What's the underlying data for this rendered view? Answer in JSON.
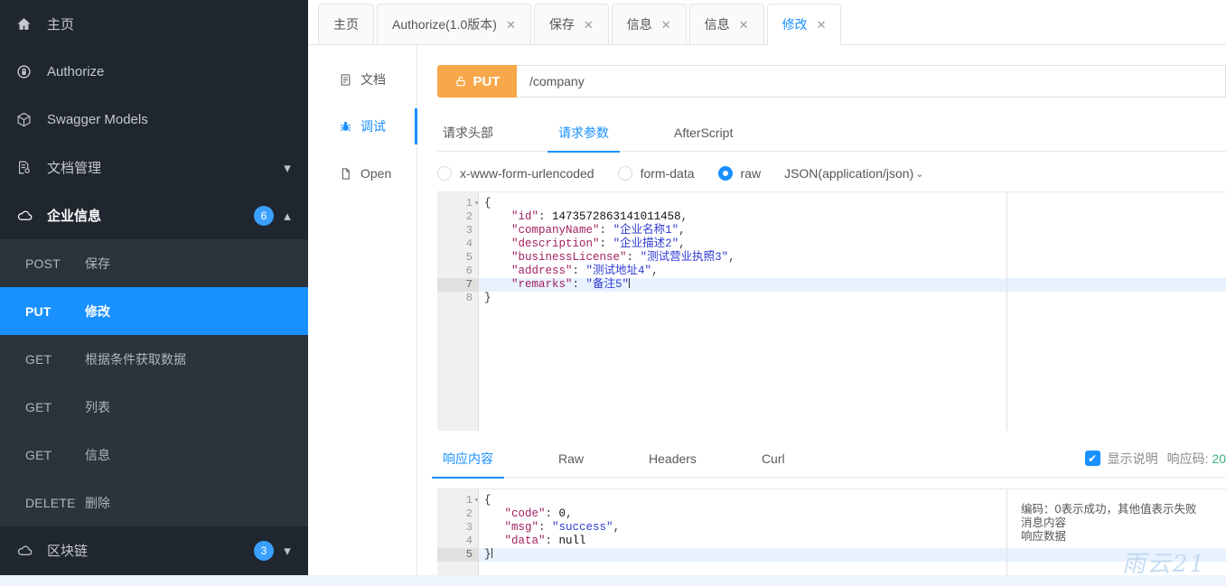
{
  "sidebar": {
    "items": [
      {
        "label": "主页",
        "icon": "home-icon",
        "kind": "link"
      },
      {
        "label": "Authorize",
        "icon": "lock-icon",
        "kind": "link"
      },
      {
        "label": "Swagger Models",
        "icon": "cube-icon",
        "kind": "link"
      },
      {
        "label": "文档管理",
        "icon": "document-settings-icon",
        "kind": "group",
        "caret": "▾"
      },
      {
        "label": "企业信息",
        "icon": "cloud-icon",
        "kind": "group",
        "badge": "6",
        "caret": "▴",
        "expanded": true
      },
      {
        "label": "区块链",
        "icon": "cloud-icon",
        "kind": "group",
        "badge": "3",
        "caret": "▾"
      }
    ],
    "submenu": [
      {
        "method": "POST",
        "name": "保存",
        "active": false
      },
      {
        "method": "PUT",
        "name": "修改",
        "active": true
      },
      {
        "method": "GET",
        "name": "根据条件获取数据",
        "active": false
      },
      {
        "method": "GET",
        "name": "列表",
        "active": false
      },
      {
        "method": "GET",
        "name": "信息",
        "active": false
      },
      {
        "method": "DELETE",
        "name": "删除",
        "active": false
      }
    ]
  },
  "tabs": [
    {
      "label": "主页",
      "closable": false,
      "active": false
    },
    {
      "label": "Authorize(1.0版本)",
      "closable": true,
      "active": false
    },
    {
      "label": "保存",
      "closable": true,
      "active": false
    },
    {
      "label": "信息",
      "closable": true,
      "active": false
    },
    {
      "label": "信息",
      "closable": true,
      "active": false
    },
    {
      "label": "修改",
      "closable": true,
      "active": true
    }
  ],
  "tab_close_glyph": "✕",
  "rail": [
    {
      "label": "文档",
      "icon": "doc-icon",
      "active": false
    },
    {
      "label": "调试",
      "icon": "bug-icon",
      "active": true
    },
    {
      "label": "Open",
      "icon": "file-icon",
      "active": false
    }
  ],
  "request": {
    "method": "PUT",
    "method_icon": "unlock-icon",
    "url": "/company",
    "subtabs": [
      {
        "label": "请求头部",
        "active": false
      },
      {
        "label": "请求参数",
        "active": true
      },
      {
        "label": "AfterScript",
        "active": false
      }
    ],
    "body_types": [
      {
        "label": "x-www-form-urlencoded",
        "checked": false
      },
      {
        "label": "form-data",
        "checked": false
      },
      {
        "label": "raw",
        "checked": true
      }
    ],
    "content_type": "JSON(application/json)",
    "content_type_chevron": "⌄",
    "editor": {
      "current_line": 7,
      "lines": [
        {
          "no": "1",
          "fold": "▾",
          "tokens": [
            {
              "t": "{",
              "c": "p"
            }
          ]
        },
        {
          "no": "2",
          "tokens": [
            {
              "t": "    ",
              "c": "p"
            },
            {
              "t": "\"id\"",
              "c": "k"
            },
            {
              "t": ": ",
              "c": "p"
            },
            {
              "t": "1473572863141011458",
              "c": "n"
            },
            {
              "t": ",",
              "c": "p"
            }
          ]
        },
        {
          "no": "3",
          "tokens": [
            {
              "t": "    ",
              "c": "p"
            },
            {
              "t": "\"companyName\"",
              "c": "k"
            },
            {
              "t": ": ",
              "c": "p"
            },
            {
              "t": "\"企业名称1\"",
              "c": "s"
            },
            {
              "t": ",",
              "c": "p"
            }
          ]
        },
        {
          "no": "4",
          "tokens": [
            {
              "t": "    ",
              "c": "p"
            },
            {
              "t": "\"description\"",
              "c": "k"
            },
            {
              "t": ": ",
              "c": "p"
            },
            {
              "t": "\"企业描述2\"",
              "c": "s"
            },
            {
              "t": ",",
              "c": "p"
            }
          ]
        },
        {
          "no": "5",
          "tokens": [
            {
              "t": "    ",
              "c": "p"
            },
            {
              "t": "\"businessLicense\"",
              "c": "k"
            },
            {
              "t": ": ",
              "c": "p"
            },
            {
              "t": "\"测试营业执照3\"",
              "c": "s"
            },
            {
              "t": ",",
              "c": "p"
            }
          ]
        },
        {
          "no": "6",
          "tokens": [
            {
              "t": "    ",
              "c": "p"
            },
            {
              "t": "\"address\"",
              "c": "k"
            },
            {
              "t": ": ",
              "c": "p"
            },
            {
              "t": "\"测试地址4\"",
              "c": "s"
            },
            {
              "t": ",",
              "c": "p"
            }
          ]
        },
        {
          "no": "7",
          "tokens": [
            {
              "t": "    ",
              "c": "p"
            },
            {
              "t": "\"remarks\"",
              "c": "k"
            },
            {
              "t": ": ",
              "c": "p"
            },
            {
              "t": "\"备注5\"",
              "c": "s"
            }
          ]
        },
        {
          "no": "8",
          "tokens": [
            {
              "t": "}",
              "c": "p"
            }
          ]
        }
      ]
    }
  },
  "response": {
    "tabs": [
      {
        "label": "响应内容",
        "active": true
      },
      {
        "label": "Raw",
        "active": false
      },
      {
        "label": "Headers",
        "active": false
      },
      {
        "label": "Curl",
        "active": false
      }
    ],
    "show_desc_label": "显示说明",
    "show_desc_checked": true,
    "check_glyph": "✔",
    "code_label": "响应码: ",
    "code_value": "20",
    "editor": {
      "current_line": 5,
      "lines": [
        {
          "no": "1",
          "fold": "▾",
          "tokens": [
            {
              "t": "{",
              "c": "p"
            }
          ]
        },
        {
          "no": "2",
          "tokens": [
            {
              "t": "   ",
              "c": "p"
            },
            {
              "t": "\"code\"",
              "c": "k"
            },
            {
              "t": ": ",
              "c": "p"
            },
            {
              "t": "0",
              "c": "n"
            },
            {
              "t": ",",
              "c": "p"
            }
          ]
        },
        {
          "no": "3",
          "tokens": [
            {
              "t": "   ",
              "c": "p"
            },
            {
              "t": "\"msg\"",
              "c": "k"
            },
            {
              "t": ": ",
              "c": "p"
            },
            {
              "t": "\"success\"",
              "c": "s"
            },
            {
              "t": ",",
              "c": "p"
            }
          ]
        },
        {
          "no": "4",
          "tokens": [
            {
              "t": "   ",
              "c": "p"
            },
            {
              "t": "\"data\"",
              "c": "k"
            },
            {
              "t": ": ",
              "c": "p"
            },
            {
              "t": "null",
              "c": "n"
            }
          ]
        },
        {
          "no": "5",
          "tokens": [
            {
              "t": "}",
              "c": "p"
            }
          ]
        }
      ]
    },
    "annotations": [
      "",
      "编码：0表示成功，其他值表示失败",
      "消息内容",
      "响应数据"
    ]
  },
  "watermark": "雨云21",
  "colors": {
    "sidebar_bg": "#20262f",
    "submenu_bg": "#2b333d",
    "accent": "#1890ff",
    "method_put": "#f7a84a",
    "badge": "#3aa0ff",
    "success_green": "#3db37a"
  }
}
